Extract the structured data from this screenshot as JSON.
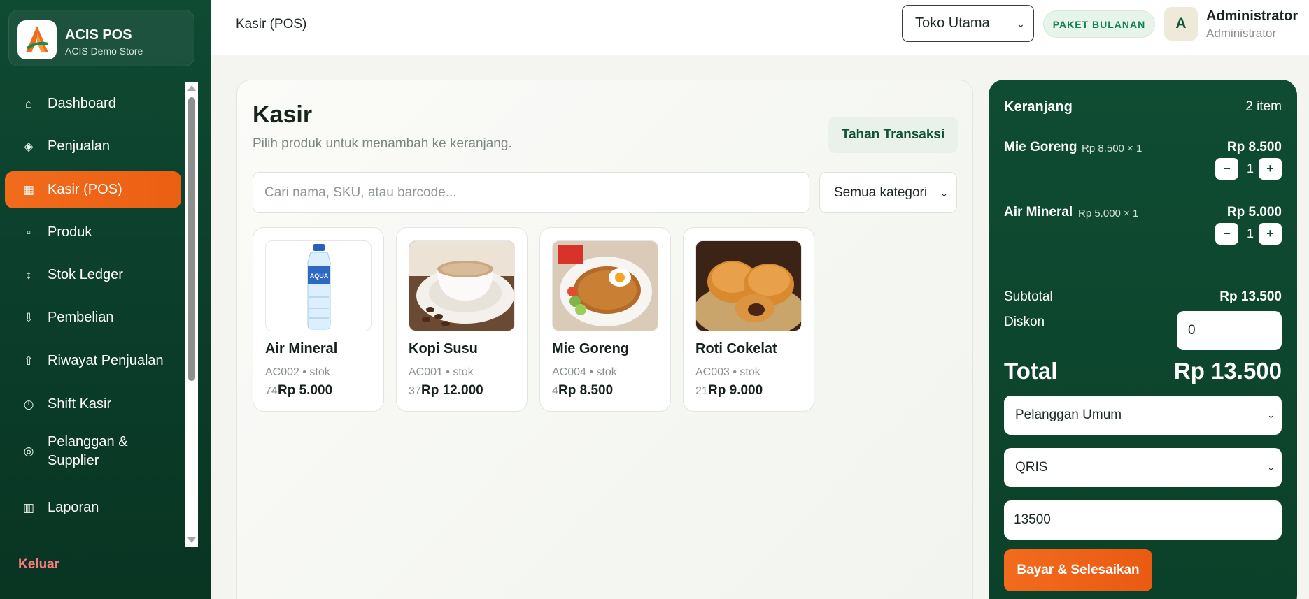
{
  "brand": {
    "name": "ACIS POS",
    "store": "ACIS Demo Store",
    "logo_icon": "acis-logo"
  },
  "sidebar": {
    "items": [
      {
        "label": "Dashboard",
        "icon": "home-icon",
        "glyph": "⌂"
      },
      {
        "label": "Penjualan",
        "icon": "diamond-icon",
        "glyph": "◈"
      },
      {
        "label": "Kasir (POS)",
        "icon": "grid-icon",
        "glyph": "▦"
      },
      {
        "label": "Produk",
        "icon": "box-icon",
        "glyph": "▫"
      },
      {
        "label": "Stok Ledger",
        "icon": "updown-arrow-icon",
        "glyph": "↕"
      },
      {
        "label": "Pembelian",
        "icon": "download-icon",
        "glyph": "⇩"
      },
      {
        "label": "Riwayat Penjualan",
        "icon": "upload-icon",
        "glyph": "⇧"
      },
      {
        "label": "Shift Kasir",
        "icon": "clock-icon",
        "glyph": "◷"
      },
      {
        "label": "Pelanggan & Supplier",
        "icon": "user-circle-icon",
        "glyph": "◎"
      },
      {
        "label": "Laporan",
        "icon": "report-icon",
        "glyph": "▥"
      }
    ],
    "active": "Kasir (POS)",
    "logout": "Keluar"
  },
  "topbar": {
    "breadcrumb": "Kasir (POS)",
    "store_select": "Toko Utama",
    "plan_badge": "PAKET BULANAN",
    "avatar_initial": "A",
    "user_name": "Administrator",
    "user_role": "Administrator"
  },
  "main": {
    "title": "Kasir",
    "subtitle": "Pilih produk untuk menambah ke keranjang.",
    "hold_button": "Tahan Transaksi",
    "search_placeholder": "Cari nama, SKU, atau barcode...",
    "category_select": "Semua kategori",
    "products": [
      {
        "name": "Air Mineral",
        "sku": "AC002 • stok",
        "stock": "74",
        "price": "Rp 5.000",
        "image": "water-bottle"
      },
      {
        "name": "Kopi Susu",
        "sku": "AC001 • stok",
        "stock": "37",
        "price": "Rp 12.000",
        "image": "coffee-cup"
      },
      {
        "name": "Mie Goreng",
        "sku": "AC004 • stok",
        "stock": "4",
        "price": "Rp 8.500",
        "image": "fried-noodles"
      },
      {
        "name": "Roti Cokelat",
        "sku": "AC003 • stok",
        "stock": "21",
        "price": "Rp 9.000",
        "image": "chocolate-bread"
      }
    ]
  },
  "cart": {
    "title": "Keranjang",
    "count": "2 item",
    "items": [
      {
        "name": "Mie Goreng",
        "meta": "Rp 8.500 × 1",
        "total": "Rp 8.500",
        "qty": "1",
        "minus": "−",
        "plus": "+"
      },
      {
        "name": "Air Mineral",
        "meta": "Rp 5.000 × 1",
        "total": "Rp 5.000",
        "qty": "1",
        "minus": "−",
        "plus": "+"
      }
    ],
    "subtotal_label": "Subtotal",
    "subtotal": "Rp 13.500",
    "discount_label": "Diskon",
    "discount": "0",
    "total_label": "Total",
    "total": "Rp 13.500",
    "customer": "Pelanggan Umum",
    "payment_method": "QRIS",
    "amount_paid": "13500",
    "pay_button": "Bayar & Selesaikan"
  },
  "colors": {
    "sidebar": "#0f4a33",
    "accent": "#f26b1d",
    "cart": "#0f4c33",
    "badge": "#118050"
  }
}
